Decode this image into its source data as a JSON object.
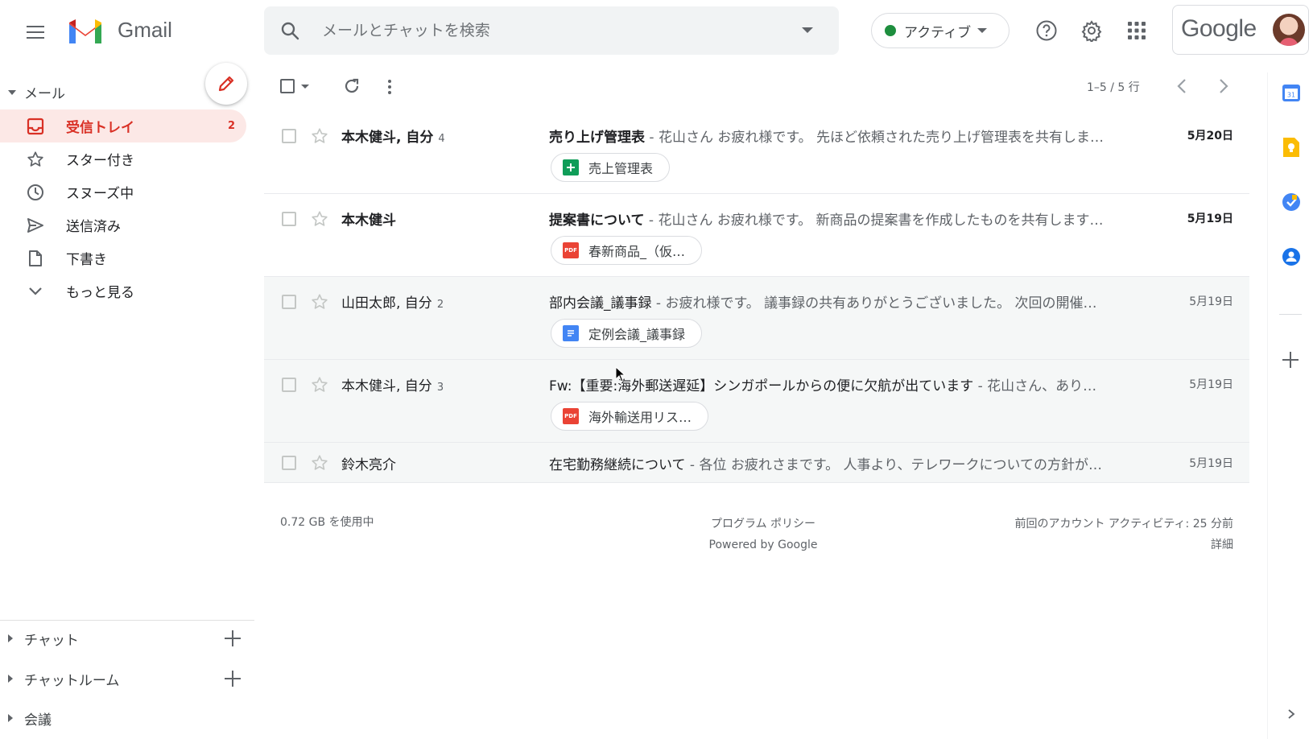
{
  "app": {
    "logo_text": "Gmail",
    "google_word": "Google"
  },
  "search": {
    "placeholder": "メールとチャットを検索"
  },
  "status": {
    "label": "アクティブ",
    "color": "#1e8e3e"
  },
  "sidebar": {
    "mail_section": "メール",
    "items": [
      {
        "label": "受信トレイ",
        "count": "2",
        "icon": "inbox-icon"
      },
      {
        "label": "スター付き",
        "count": "",
        "icon": "star-icon"
      },
      {
        "label": "スヌーズ中",
        "count": "",
        "icon": "clock-icon"
      },
      {
        "label": "送信済み",
        "count": "",
        "icon": "send-icon"
      },
      {
        "label": "下書き",
        "count": "",
        "icon": "draft-icon"
      },
      {
        "label": "もっと見る",
        "count": "",
        "icon": "chevron-down-icon"
      }
    ],
    "sections": [
      {
        "label": "チャット"
      },
      {
        "label": "チャットルーム"
      },
      {
        "label": "会議"
      }
    ]
  },
  "toolbar": {
    "pager": "1–5 / 5 行"
  },
  "emails": [
    {
      "sender": "本木健斗, 自分",
      "count": "4",
      "subject": "売り上げ管理表",
      "snippet": " - 花山さん お疲れ様です。 先ほど依頼された売り上げ管理表を共有しま…",
      "date": "5月20日",
      "unread": true,
      "attachment": {
        "label": "売上管理表",
        "type": "sheets"
      }
    },
    {
      "sender": "本木健斗",
      "count": "",
      "subject": "提案書について",
      "snippet": " - 花山さん お疲れ様です。 新商品の提案書を作成したものを共有します…",
      "date": "5月19日",
      "unread": true,
      "attachment": {
        "label": "春新商品_（仮…",
        "type": "pdf"
      }
    },
    {
      "sender": "山田太郎, 自分",
      "count": "2",
      "subject": "部内会議_議事録",
      "snippet": " - お疲れ様です。 議事録の共有ありがとうございました。 次回の開催…",
      "date": "5月19日",
      "unread": false,
      "attachment": {
        "label": "定例会議_議事録",
        "type": "docs"
      }
    },
    {
      "sender": "本木健斗, 自分",
      "count": "3",
      "subject": "Fw:【重要:海外郵送遅延】シンガポールからの便に欠航が出ています",
      "snippet": " - 花山さん、あり…",
      "date": "5月19日",
      "unread": false,
      "attachment": {
        "label": "海外輸送用リス…",
        "type": "pdf"
      }
    },
    {
      "sender": "鈴木亮介",
      "count": "",
      "subject": "在宅勤務継続について",
      "snippet": " - 各位 お疲れさまです。 人事より、テレワークについての方針が…",
      "date": "5月19日",
      "unread": false,
      "attachment": null
    }
  ],
  "footer": {
    "storage": "0.72 GB を使用中",
    "policy": "プログラム ポリシー",
    "powered": "Powered by Google",
    "activity": "前回のアカウント アクティビティ: 25 分前",
    "details": "詳細"
  },
  "colors": {
    "accent_red": "#d93025",
    "sheets_green": "#0f9d58",
    "pdf_red": "#ea4335",
    "docs_blue": "#4285f4"
  }
}
